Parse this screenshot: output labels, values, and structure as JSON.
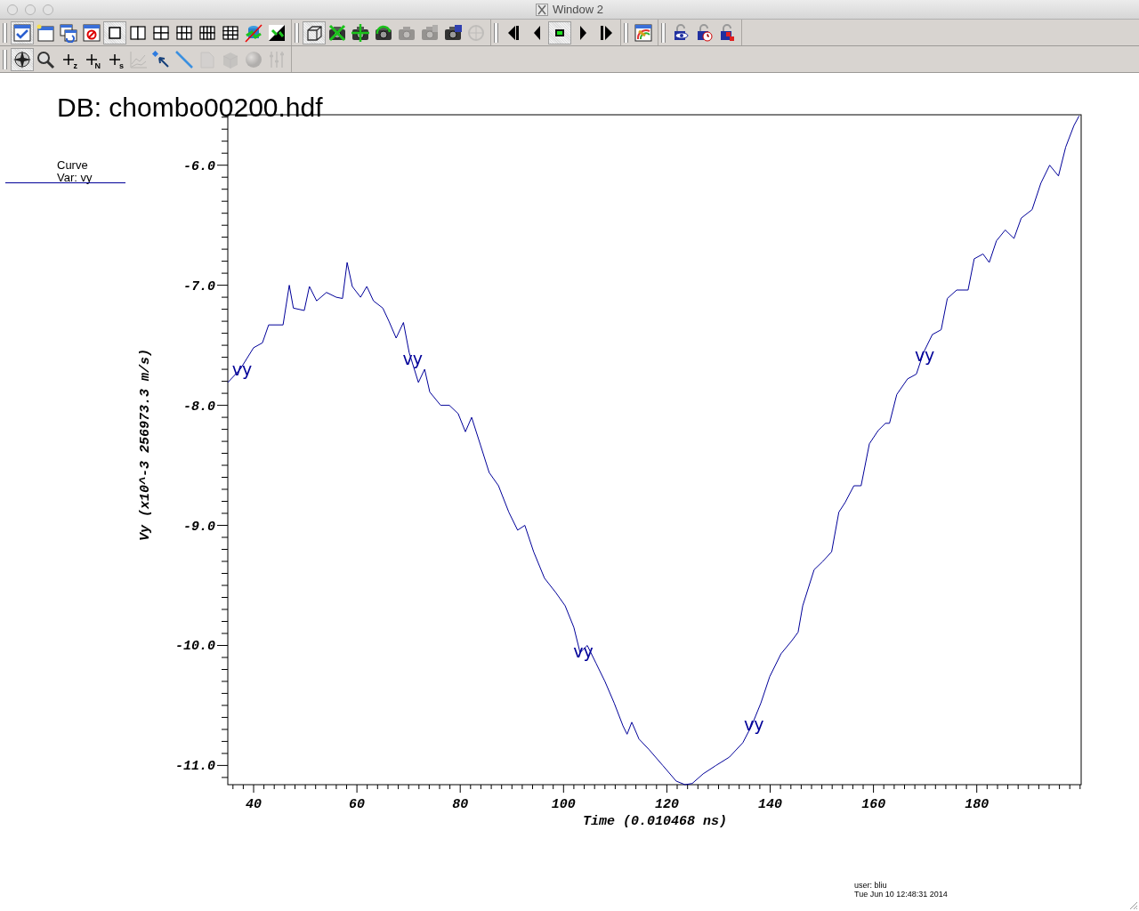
{
  "window": {
    "title": "Window 2"
  },
  "toolbars": [
    [
      [
        {
          "kind": "active-window",
          "selected": true,
          "disabled": false
        },
        {
          "kind": "new-window",
          "selected": false,
          "disabled": false
        },
        {
          "kind": "clone-window",
          "selected": false,
          "disabled": false
        },
        {
          "kind": "delete-window",
          "selected": false,
          "disabled": false
        },
        {
          "kind": "layout-1",
          "selected": true,
          "disabled": false
        },
        {
          "kind": "layout-2",
          "selected": false,
          "disabled": false
        },
        {
          "kind": "layout-4",
          "selected": false,
          "disabled": false
        },
        {
          "kind": "layout-6",
          "selected": false,
          "disabled": false
        },
        {
          "kind": "layout-8",
          "selected": false,
          "disabled": false
        },
        {
          "kind": "layout-9",
          "selected": false,
          "disabled": false
        },
        {
          "kind": "cylinder-strike",
          "selected": false,
          "disabled": false
        },
        {
          "kind": "invert",
          "selected": false,
          "disabled": false
        }
      ],
      [
        {
          "kind": "cube",
          "selected": true,
          "disabled": false
        },
        {
          "kind": "camera-cross",
          "selected": false,
          "disabled": false
        },
        {
          "kind": "camera-arrows",
          "selected": false,
          "disabled": false
        },
        {
          "kind": "camera-cycle",
          "selected": false,
          "disabled": false
        },
        {
          "kind": "camera",
          "selected": false,
          "disabled": true
        },
        {
          "kind": "camera-stack",
          "selected": false,
          "disabled": true
        },
        {
          "kind": "camera-disk",
          "selected": false,
          "disabled": false
        },
        {
          "kind": "spin",
          "selected": false,
          "disabled": true
        }
      ],
      [
        {
          "kind": "skip-back",
          "selected": false,
          "disabled": false
        },
        {
          "kind": "step-back",
          "selected": false,
          "disabled": false
        },
        {
          "kind": "stop",
          "selected": true,
          "disabled": false
        },
        {
          "kind": "play",
          "selected": false,
          "disabled": false
        },
        {
          "kind": "skip-forward",
          "selected": false,
          "disabled": false
        }
      ],
      [
        {
          "kind": "palette",
          "selected": false,
          "disabled": false
        }
      ],
      [
        {
          "kind": "lock-eye",
          "selected": false,
          "disabled": false
        },
        {
          "kind": "lock-clock",
          "selected": false,
          "disabled": false
        },
        {
          "kind": "lock-tools",
          "selected": false,
          "disabled": false
        }
      ]
    ],
    [
      [
        {
          "kind": "compass",
          "selected": true,
          "disabled": false
        },
        {
          "kind": "zoom",
          "selected": false,
          "disabled": false
        },
        {
          "kind": "plus-letter",
          "label": "z",
          "selected": false,
          "disabled": false
        },
        {
          "kind": "plus-letter",
          "label": "N",
          "selected": false,
          "disabled": false
        },
        {
          "kind": "plus-letter",
          "label": "s",
          "selected": false,
          "disabled": false
        },
        {
          "kind": "chart",
          "selected": false,
          "disabled": true
        },
        {
          "kind": "pick",
          "selected": false,
          "disabled": false
        },
        {
          "kind": "line",
          "selected": false,
          "disabled": false
        },
        {
          "kind": "page",
          "selected": false,
          "disabled": true
        },
        {
          "kind": "box",
          "selected": false,
          "disabled": true
        },
        {
          "kind": "sphere",
          "selected": false,
          "disabled": true
        },
        {
          "kind": "sliders",
          "selected": false,
          "disabled": true
        }
      ]
    ]
  ],
  "plot": {
    "title": "DB: chombo00200.hdf",
    "legend": {
      "title": "Curve",
      "var": "Var: vy"
    },
    "chart_data": {
      "type": "line",
      "xlabel": "Time (0.010468 ns)",
      "ylabel": "Vy (x10^-3 256973.3 m/s)",
      "x": [
        35,
        37.4,
        40,
        41.7,
        42.9,
        45.7,
        46.9,
        47.7,
        49.8,
        50.8,
        52.2,
        54.1,
        56,
        57.2,
        58.1,
        59.1,
        60.7,
        61.9,
        63.2,
        65,
        66.2,
        67.6,
        69,
        70.1,
        71.9,
        73.1,
        74.1,
        76.2,
        77.9,
        79.6,
        81,
        82.2,
        83.9,
        85.6,
        87.4,
        89.4,
        91.1,
        92.5,
        94.2,
        96.3,
        98.5,
        100.3,
        102,
        103.2,
        104.6,
        106.3,
        108,
        109.8,
        111.5,
        112.3,
        113.2,
        114.6,
        116.6,
        119.2,
        121.8,
        123.5,
        124.9,
        127,
        129.5,
        132.1,
        134.7,
        136.4,
        138.2,
        139.9,
        142.1,
        144.2,
        145.4,
        146.3,
        148.5,
        150.2,
        151.9,
        153.3,
        154.5,
        156.2,
        157.6,
        159.2,
        160.9,
        162.3,
        163.1,
        164.5,
        166.6,
        168.3,
        169.7,
        171.4,
        173.1,
        174.3,
        176.1,
        178.3,
        179.5,
        181.2,
        182.4,
        183.8,
        185.5,
        187.2,
        188.6,
        190.7,
        192.4,
        194.1,
        195.8,
        197.2,
        198.8,
        199.8
      ],
      "series": [
        {
          "name": "vy",
          "color": "#000099",
          "values": [
            -7.81,
            -7.7,
            -7.52,
            -7.48,
            -7.33,
            -7.33,
            -7.0,
            -7.19,
            -7.21,
            -7.01,
            -7.13,
            -7.06,
            -7.1,
            -7.11,
            -6.81,
            -7.01,
            -7.1,
            -7.01,
            -7.13,
            -7.19,
            -7.3,
            -7.44,
            -7.31,
            -7.56,
            -7.81,
            -7.7,
            -7.89,
            -8.0,
            -8.0,
            -8.07,
            -8.22,
            -8.1,
            -8.33,
            -8.56,
            -8.67,
            -8.89,
            -9.04,
            -9.0,
            -9.22,
            -9.44,
            -9.56,
            -9.67,
            -9.85,
            -10.06,
            -10.0,
            -10.15,
            -10.3,
            -10.48,
            -10.67,
            -10.74,
            -10.64,
            -10.78,
            -10.87,
            -11.0,
            -11.13,
            -11.16,
            -11.15,
            -11.07,
            -11.0,
            -10.93,
            -10.81,
            -10.67,
            -10.48,
            -10.26,
            -10.07,
            -9.96,
            -9.89,
            -9.67,
            -9.37,
            -9.3,
            -9.22,
            -8.89,
            -8.81,
            -8.67,
            -8.67,
            -8.32,
            -8.21,
            -8.15,
            -8.15,
            -7.91,
            -7.78,
            -7.74,
            -7.56,
            -7.41,
            -7.37,
            -7.11,
            -7.04,
            -7.04,
            -6.78,
            -6.74,
            -6.81,
            -6.63,
            -6.54,
            -6.61,
            -6.44,
            -6.37,
            -6.15,
            -6.0,
            -6.09,
            -5.85,
            -5.67,
            -5.59
          ]
        }
      ],
      "xlim": [
        35,
        200.2
      ],
      "ylim": [
        -11.16,
        -5.58
      ],
      "xticks": [
        40,
        60,
        80,
        100,
        120,
        140,
        160,
        180
      ],
      "yticks": [
        {
          "value": -6,
          "label": "-6.0"
        },
        {
          "value": -7,
          "label": "-7.0"
        },
        {
          "value": -8,
          "label": "-8.0"
        },
        {
          "value": -9,
          "label": "-9.0"
        },
        {
          "value": -10,
          "label": "-10.0"
        },
        {
          "value": -11,
          "label": "-11.0"
        }
      ]
    },
    "user": "user: bliu",
    "timestamp": "Tue Jun 10 12:48:31 2014"
  }
}
